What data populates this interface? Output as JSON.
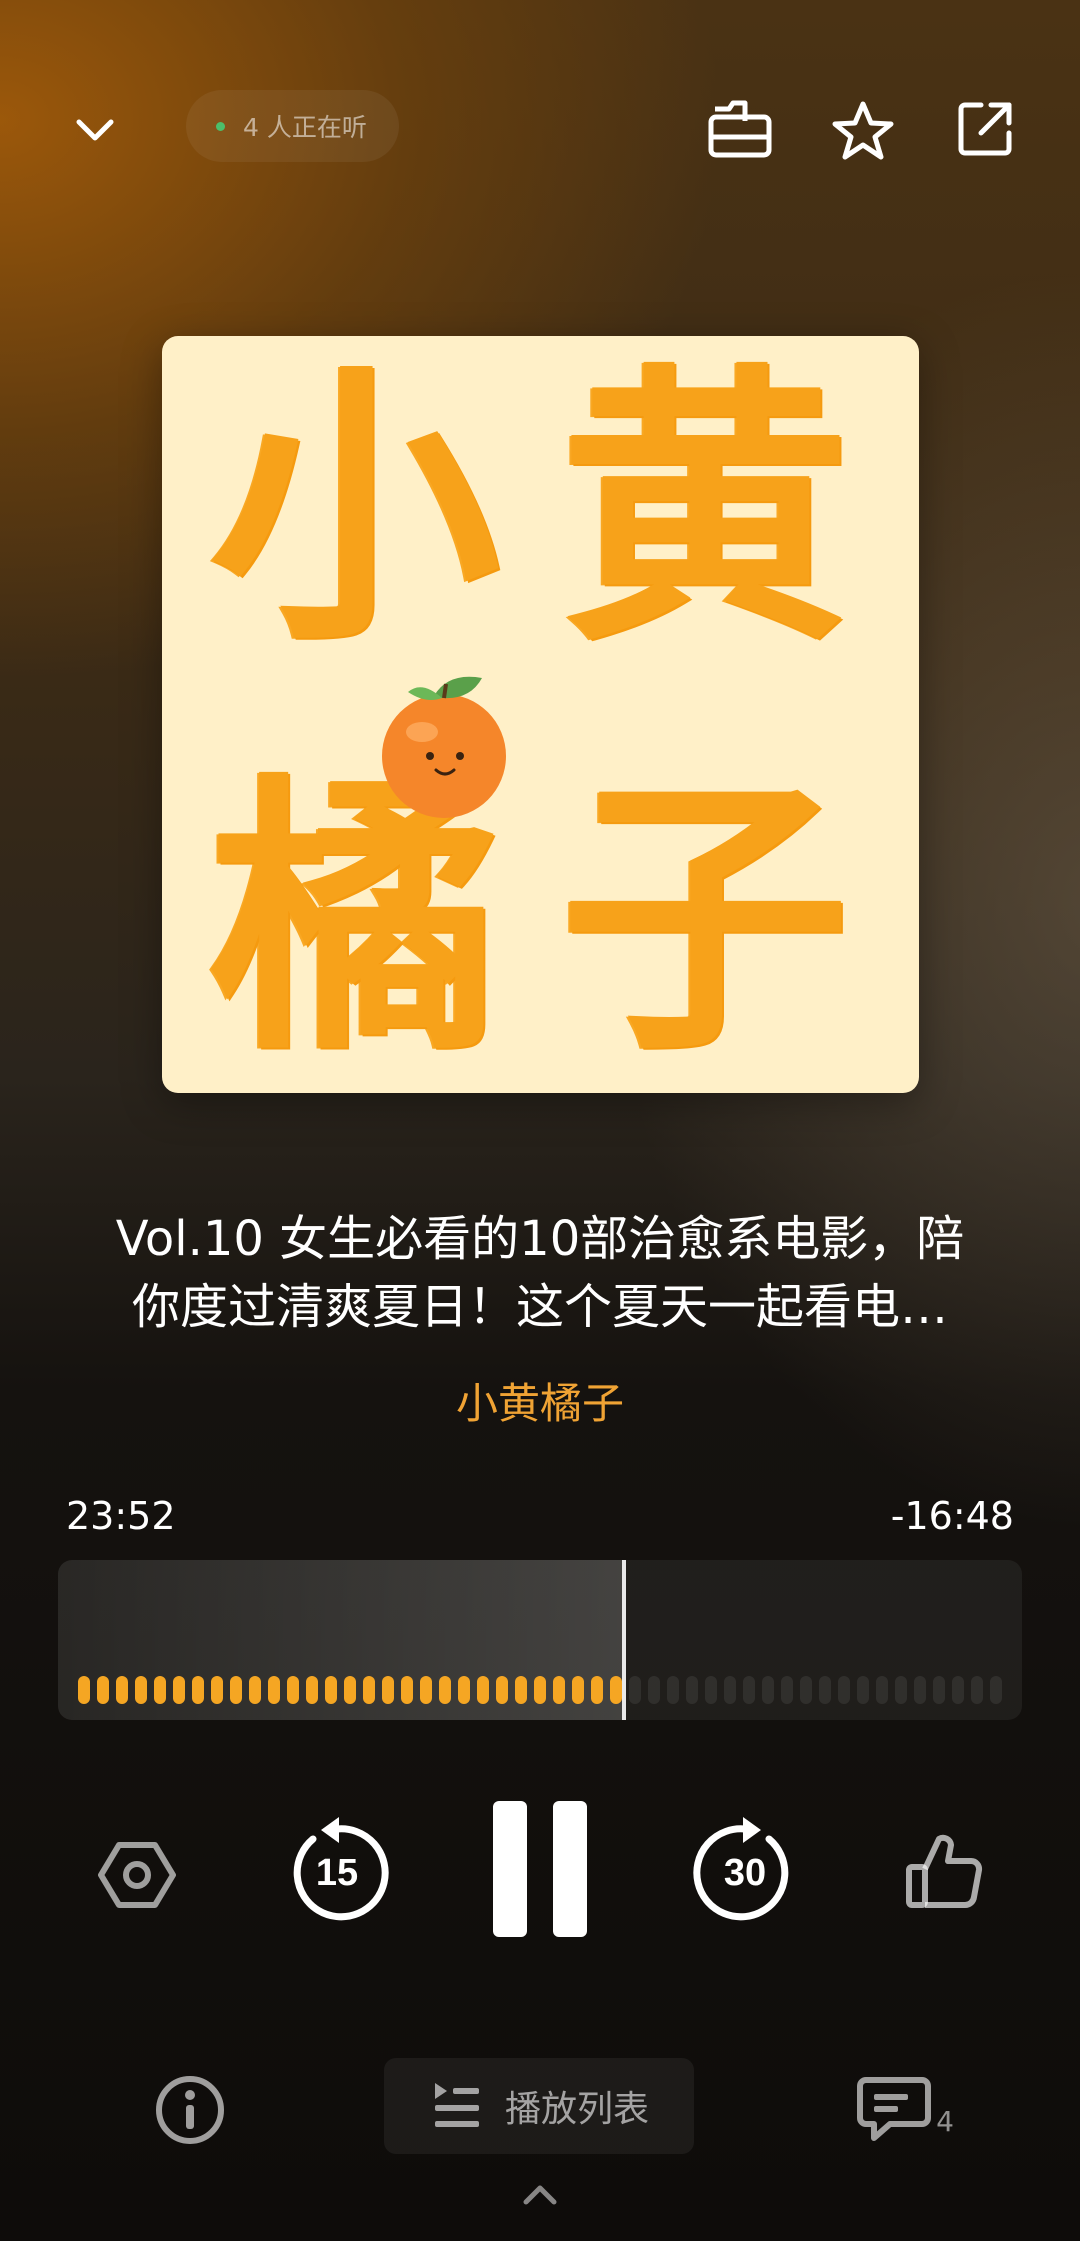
{
  "header": {
    "listeners_text": "4 人正在听"
  },
  "cover": {
    "chars": [
      "小",
      "黄",
      "橘",
      "子"
    ]
  },
  "episode": {
    "title": "Vol.10 女生必看的10部治愈系电影，陪你度过清爽夏日！这个夏天一起看电影吧",
    "author": "小黄橘子"
  },
  "progress": {
    "elapsed": "23:52",
    "remaining": "-16:48",
    "fraction": 0.587
  },
  "controls": {
    "rewind_seconds": "15",
    "forward_seconds": "30"
  },
  "bottom": {
    "playlist_label": "播放列表",
    "comment_count": "4"
  },
  "colors": {
    "accent": "#f0a334",
    "waveform_played": "#f5a623",
    "cover_bg": "#fff0c8",
    "cover_text": "#f7a21a",
    "listeners_dot": "#4cbf6a"
  },
  "icons": {
    "collapse": "chevron-down-icon",
    "subscribe": "subscribe-icon",
    "favorite": "star-icon",
    "share": "share-icon",
    "settings": "hexagon-settings-icon",
    "rewind": "rewind-15-icon",
    "pause": "pause-icon",
    "forward": "forward-30-icon",
    "like": "thumbs-up-icon",
    "info": "info-icon",
    "playlist": "playlist-icon",
    "comments": "comment-icon",
    "expand": "chevron-up-icon"
  }
}
